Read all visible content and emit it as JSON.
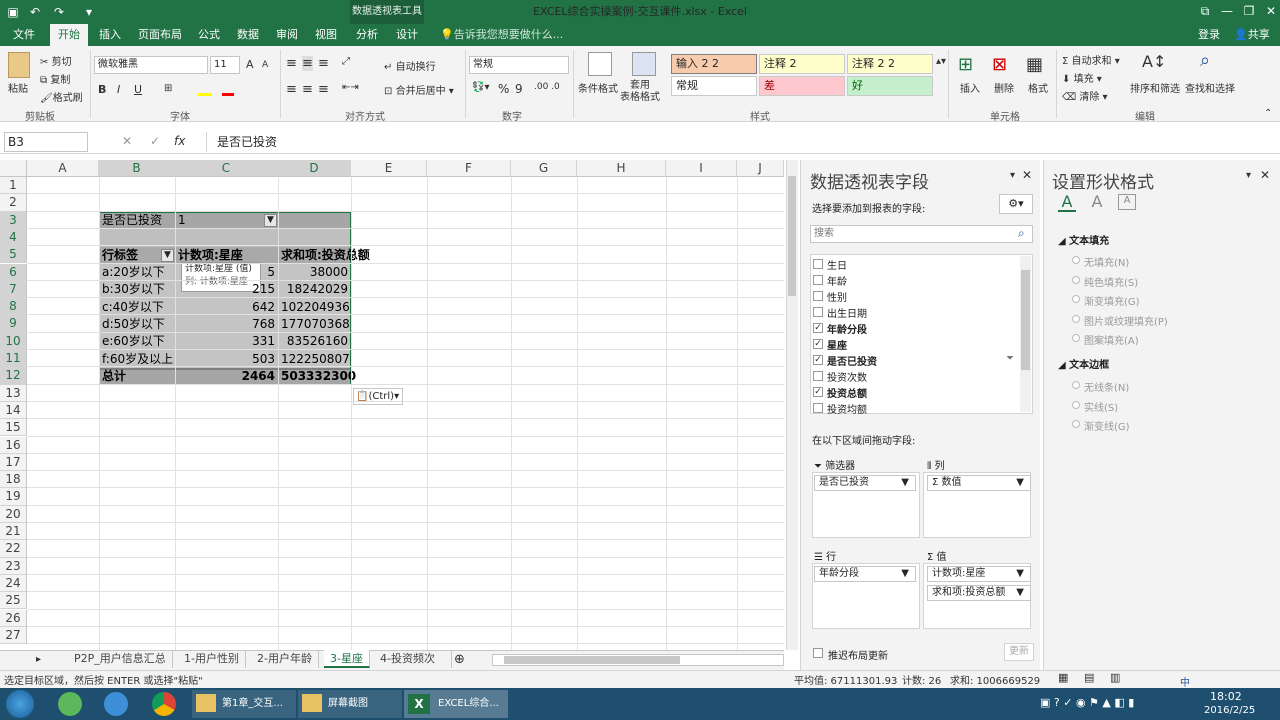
{
  "window": {
    "title": "EXCEL综合实操案例-交互课件.xlsx - Excel",
    "context_tab": "数据透视表工具"
  },
  "ribbon_tabs": [
    "文件",
    "开始",
    "插入",
    "页面布局",
    "公式",
    "数据",
    "审阅",
    "视图",
    "分析",
    "设计"
  ],
  "tell_me": "告诉我您想要做什么...",
  "account": {
    "login": "登录",
    "share": "共享"
  },
  "ribbon": {
    "clipboard": {
      "paste": "粘贴",
      "cut": "剪切",
      "copy": "复制",
      "format_painter": "格式刷",
      "label": "剪贴板"
    },
    "font": {
      "family": "微软雅黑",
      "size": "11",
      "bold": "B",
      "italic": "I",
      "underline": "U",
      "label": "字体",
      "increase": "A",
      "decrease": "A"
    },
    "align": {
      "wrap": "自动换行",
      "merge": "合并后居中",
      "label": "对齐方式"
    },
    "number": {
      "format": "常规",
      "percent": "%",
      "comma": "9",
      "label": "数字"
    },
    "styles": {
      "cond": "条件格式",
      "table": "套用\n表格格式",
      "label": "样式",
      "cells": [
        {
          "text": "输入 2 2",
          "bg": "#f8cbad"
        },
        {
          "text": "注释 2",
          "bg": "#ffffcc"
        },
        {
          "text": "注释 2 2",
          "bg": "#ffffcc"
        },
        {
          "text": "常规",
          "bg": "#ffffff"
        },
        {
          "text": "差",
          "bg": "#ffc7ce"
        },
        {
          "text": "好",
          "bg": "#c6efce"
        }
      ]
    },
    "cells": {
      "insert": "插入",
      "delete": "删除",
      "format": "格式",
      "label": "单元格"
    },
    "edit": {
      "autosum": "自动求和",
      "fill": "填充",
      "clear": "清除",
      "sort": "排序和筛选",
      "find": "查找和选择",
      "label": "编辑"
    }
  },
  "formula_bar": {
    "name_box": "B3",
    "fx": "fx",
    "value": "是否已投资"
  },
  "columns": [
    "A",
    "B",
    "C",
    "D",
    "E",
    "F",
    "G",
    "H",
    "I",
    "J"
  ],
  "rows": [
    "1",
    "2",
    "3",
    "4",
    "5",
    "6",
    "7",
    "8",
    "9",
    "10",
    "11",
    "12",
    "13",
    "14",
    "15",
    "16",
    "17",
    "18",
    "19",
    "20",
    "21",
    "22",
    "23",
    "24",
    "25",
    "26",
    "27"
  ],
  "pivot": {
    "filter_label": "是否已投资",
    "filter_value": "1",
    "headers": [
      "行标签",
      "计数项:星座",
      "求和项:投资总额"
    ],
    "rows": [
      {
        "label": "a:20岁以下",
        "count": "5",
        "sum": "38000"
      },
      {
        "label": "b:30岁以下",
        "count": "215",
        "sum": "18242029"
      },
      {
        "label": "c:40岁以下",
        "count": "642",
        "sum": "102204936"
      },
      {
        "label": "d:50岁以下",
        "count": "768",
        "sum": "177070368"
      },
      {
        "label": "e:60岁以下",
        "count": "331",
        "sum": "83526160"
      },
      {
        "label": "f:60岁及以上",
        "count": "503",
        "sum": "122250807"
      }
    ],
    "total": {
      "label": "总计",
      "count": "2464",
      "sum": "503332300"
    },
    "tooltip": {
      "line1": "计数项:星座 (值)",
      "line2": "列: 计数项:星座"
    },
    "paste_ctrl": "(Ctrl)"
  },
  "sheet_tabs": [
    "P2P_用户信息汇总",
    "1-用户性别",
    "2-用户年龄",
    "3-星座",
    "4-投资频次"
  ],
  "active_sheet": "3-星座",
  "status": {
    "left": "选定目标区域，然后按 ENTER 或选择\"粘贴\"",
    "average": "平均值: 67111301.93",
    "count": "计数: 26",
    "sum": "求和: 1006669529"
  },
  "field_pane": {
    "title": "数据透视表字段",
    "subtitle": "选择要添加到报表的字段:",
    "search_placeholder": "搜索",
    "fields": [
      {
        "name": "生日",
        "checked": false
      },
      {
        "name": "年龄",
        "checked": false
      },
      {
        "name": "性别",
        "checked": false
      },
      {
        "name": "出生日期",
        "checked": false
      },
      {
        "name": "年龄分段",
        "checked": true,
        "bold": true
      },
      {
        "name": "星座",
        "checked": true,
        "bold": true
      },
      {
        "name": "是否已投资",
        "checked": true,
        "bold": true,
        "filtered": true
      },
      {
        "name": "投资次数",
        "checked": false
      },
      {
        "name": "投资总额",
        "checked": true,
        "bold": true
      },
      {
        "name": "投资均额",
        "checked": false
      }
    ],
    "drag_hint": "在以下区域间拖动字段:",
    "zones": {
      "filter": {
        "label": "筛选器",
        "items": [
          "是否已投资"
        ]
      },
      "columns": {
        "label": "列",
        "items": [
          "Σ 数值"
        ]
      },
      "rows": {
        "label": "行",
        "items": [
          "年龄分段"
        ]
      },
      "values": {
        "label": "Σ 值",
        "items": [
          "计数项:星座",
          "求和项:投资总额"
        ]
      }
    },
    "defer": "推迟布局更新",
    "update": "更新"
  },
  "format_pane": {
    "title": "设置形状格式",
    "fill_section": "文本填充",
    "fill_options": [
      "无填充(N)",
      "纯色填充(S)",
      "渐变填充(G)",
      "图片或纹理填充(P)",
      "图案填充(A)"
    ],
    "line_section": "文本边框",
    "line_options": [
      "无线条(N)",
      "实线(S)",
      "渐变线(G)"
    ]
  },
  "taskbar": {
    "items": [
      "第1章_交互...",
      "屏幕截图",
      "EXCEL综合..."
    ],
    "time": "18:02",
    "date": "2016/2/25",
    "ime": "中"
  }
}
